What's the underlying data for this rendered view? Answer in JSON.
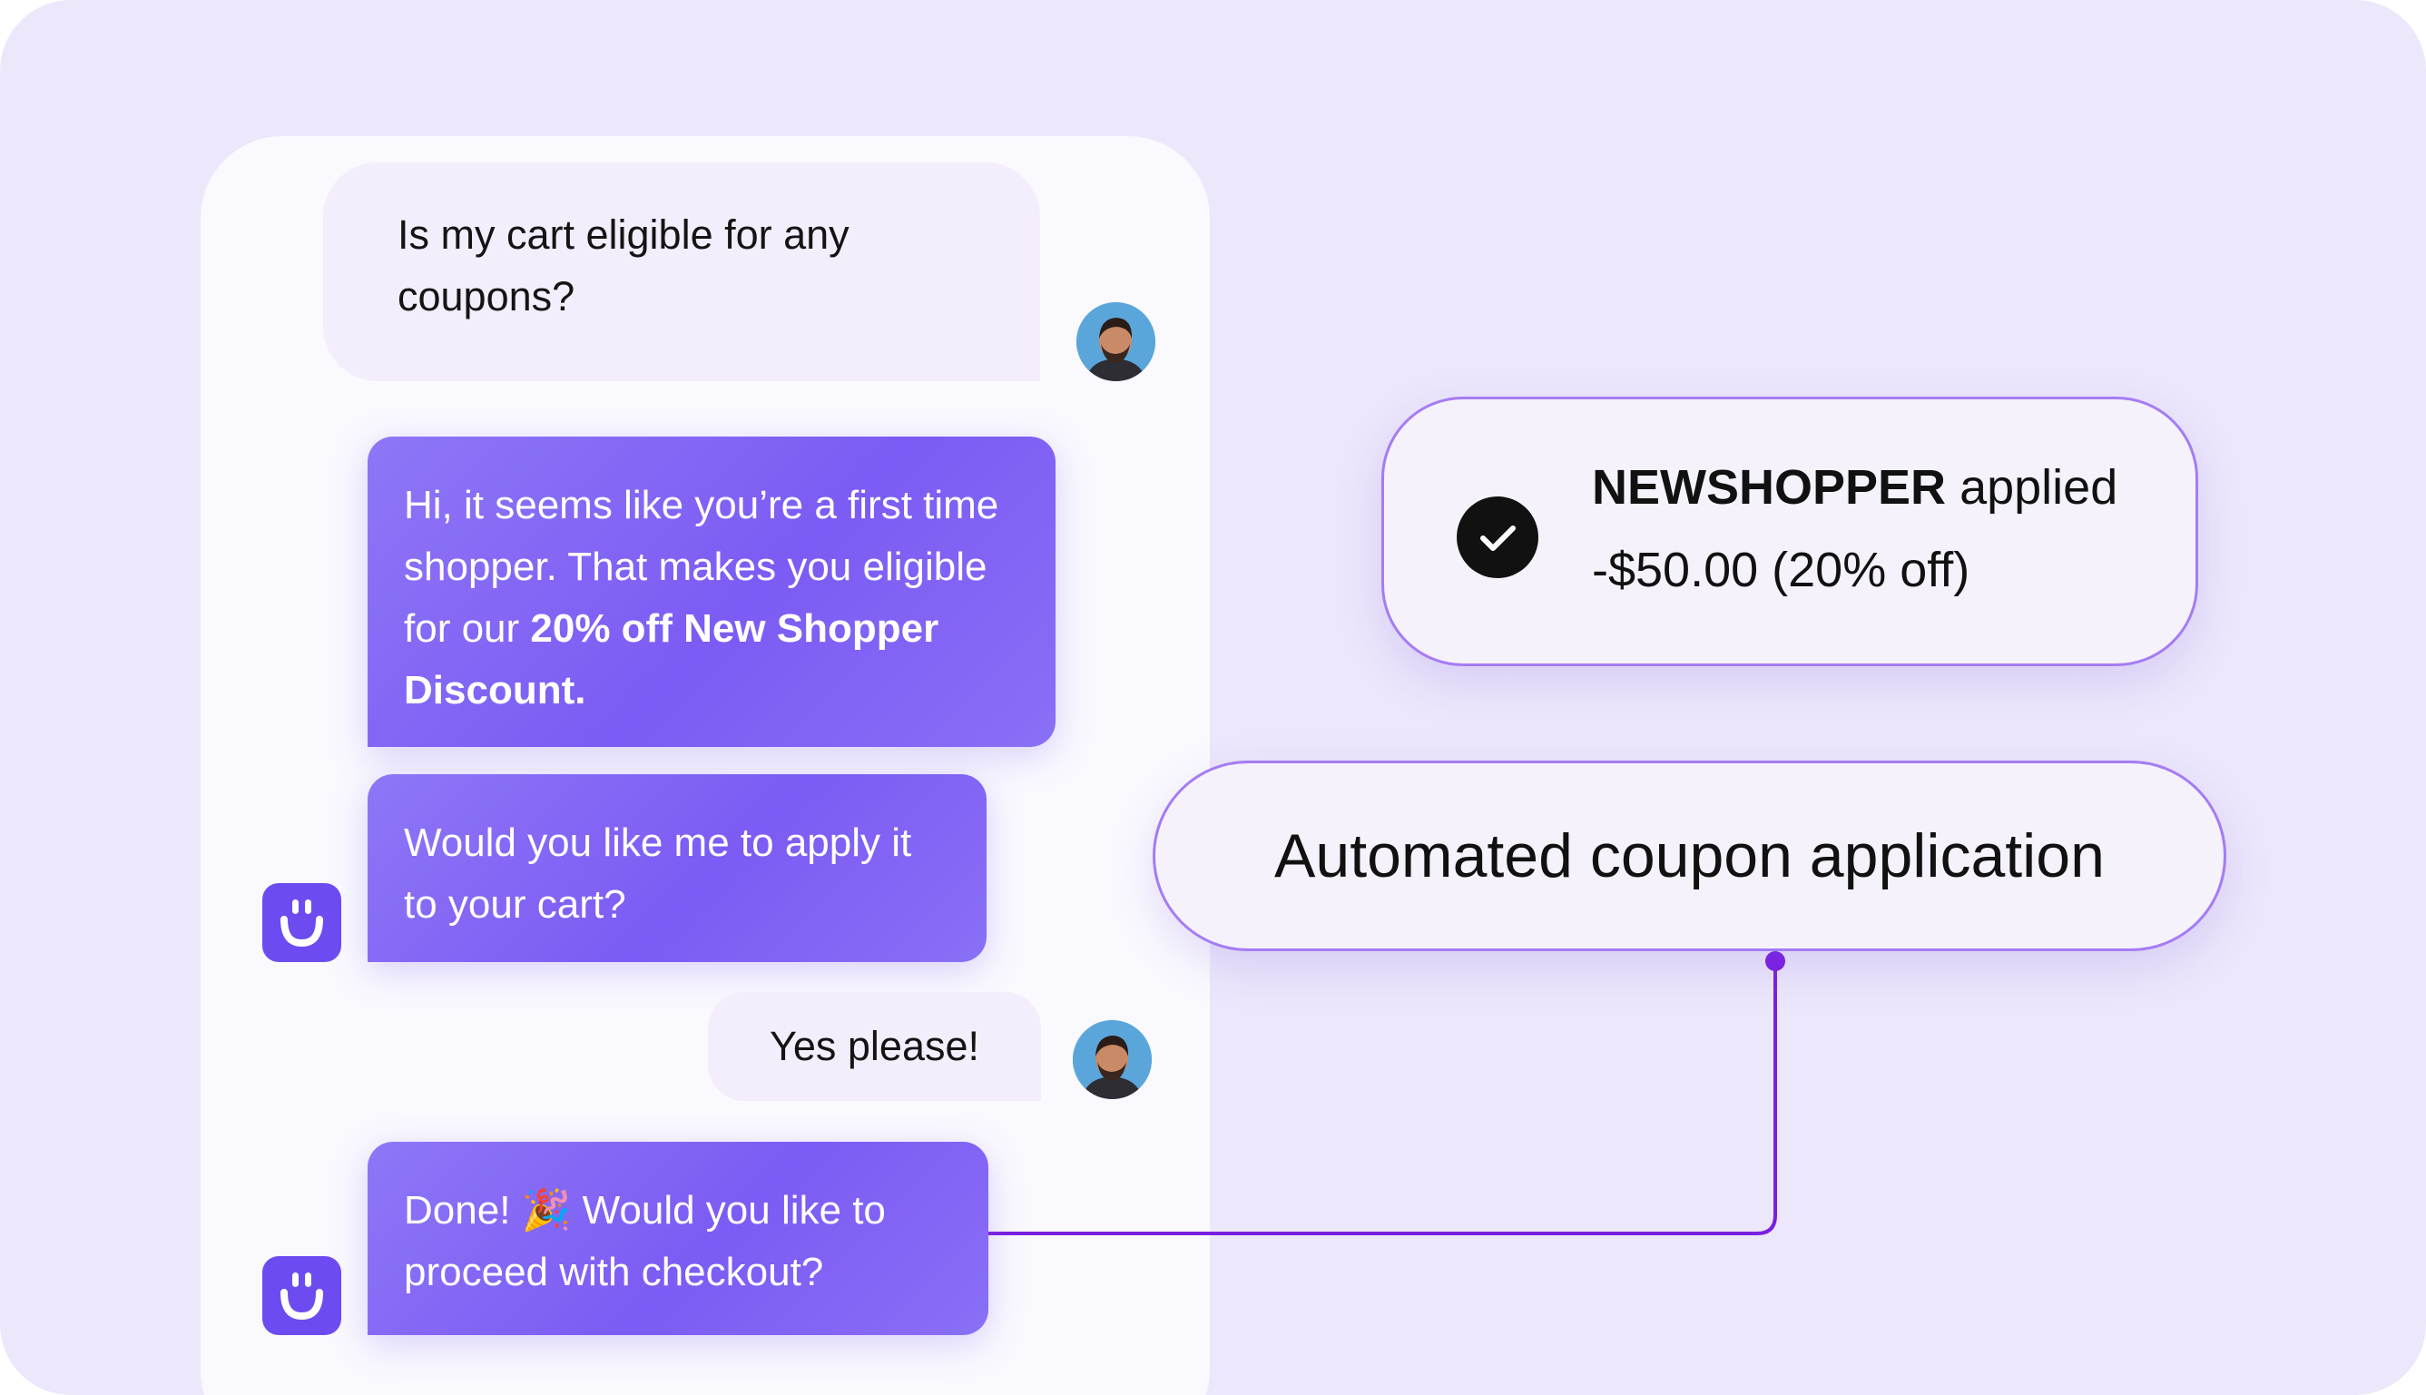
{
  "chat": {
    "messages": [
      {
        "role": "user",
        "text": "Is my cart eligible for any coupons?"
      },
      {
        "role": "bot",
        "text_before": "Hi, it seems like you’re a first time shopper. That makes you eligible for our ",
        "text_bold": "20% off New Shopper Discount."
      },
      {
        "role": "bot",
        "text": "Would you like me to apply it to your cart?"
      },
      {
        "role": "user",
        "text": "Yes please!"
      },
      {
        "role": "bot",
        "text": "Done! 🎉 Would you like to proceed with checkout?"
      }
    ]
  },
  "coupon_card": {
    "code": "NEWSHOPPER",
    "status": "applied",
    "discount": "-$50.00 (20% off)",
    "icon": "check-circle-icon"
  },
  "feature_label": "Automated coupon application",
  "icons": {
    "user_avatar": "user-avatar",
    "bot_logo": "smiley-logo-icon"
  },
  "colors": {
    "background": "#ece7fb",
    "bot_bubble": "#7b5cf4",
    "user_bubble": "#f4edfb",
    "accent": "#7a1fe0",
    "bot_logo": "#6c4cf1"
  }
}
